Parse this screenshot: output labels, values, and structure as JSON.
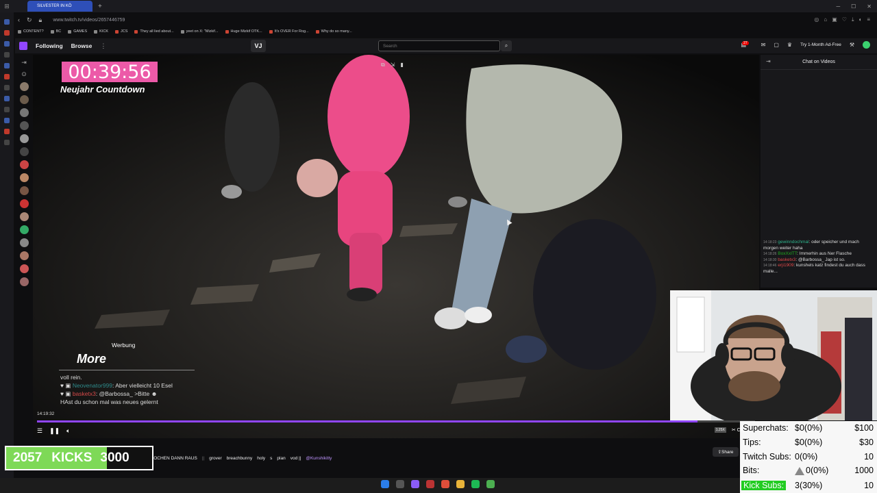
{
  "browser": {
    "active_tab": "SILVESTER IN KÖ",
    "url": "www.twitch.tv/videos/2657446759",
    "bookmarks": [
      "CONTENT?",
      "BC",
      "GAMES",
      "KICK",
      "JCS",
      "They all lied about...",
      "yeet on X: \"Mizkif...",
      "Huge Mizkif OTK...",
      "It's OVER For Rog...",
      "Why do so many..."
    ]
  },
  "twitch_nav": {
    "following": "Following",
    "browse": "Browse",
    "vj_button": "VJ",
    "search_placeholder": "Search",
    "notif_count": "27",
    "ad_free": "Try 1-Month Ad-Free"
  },
  "video": {
    "timer": "00:39:56",
    "timer_caption": "Neujahr Countdown",
    "ad_label": "Werbung",
    "ad_brand": "More",
    "overlay_chat": [
      {
        "user": "",
        "text": "voll rein."
      },
      {
        "user": "Neovenator999",
        "text": "Aber vielleicht 10 Esel"
      },
      {
        "user": "basketx3",
        "text": "@Barbossa_ >Bitte"
      },
      {
        "user": "",
        "text": "HAst du schon mal was neues gelernt"
      }
    ],
    "timestamp": "14:19:32",
    "progress_fraction": 0.92,
    "speed": "1.25X",
    "clip_label": "Clip"
  },
  "chat": {
    "header": "Chat on Videos",
    "messages": [
      {
        "time": "14:18:23",
        "user": "gewinndochmal",
        "text": "oder speicher und mach morgen weiter haha"
      },
      {
        "time": "14:18:26",
        "user": "BoxXxITT",
        "text": "Immerhin aus Ner Flasche"
      },
      {
        "time": "14:18:30",
        "user": "basketx3",
        "text": "@Barbossa_ Jap ist so."
      },
      {
        "time": "14:18:46",
        "user": "erji1909",
        "text": "kunshels katz findest du auch dass malle..."
      }
    ]
  },
  "info": {
    "tags": [
      "KARTOFFELSUPPE KOCHEN DANN RAUS",
      "||",
      "grover",
      "breachbunny",
      "holy",
      "s",
      "plan",
      "vod ||",
      "@Kunshikitty"
    ],
    "share": "Share"
  },
  "kicks_goal": {
    "current": "2057",
    "label": "KICKS",
    "goal": "3000",
    "progress_fraction": 0.69
  },
  "stats": [
    {
      "label": "Superchats:",
      "current": "$0(0%)",
      "goal": "$100"
    },
    {
      "label": "Tips:",
      "current": "$0(0%)",
      "goal": "$30"
    },
    {
      "label": "Twitch Subs:",
      "current": "0(0%)",
      "goal": "10"
    },
    {
      "label": "Bits:",
      "current": "0(0%)",
      "goal": "1000"
    },
    {
      "label": "Kick Subs:",
      "current": "3(30%)",
      "goal": "10"
    }
  ],
  "colors": {
    "twitch_purple": "#9146ff",
    "timer_bg": "#ec5aa8",
    "kicks_green": "#7ed957",
    "kick_subs_green": "#22cc22"
  }
}
